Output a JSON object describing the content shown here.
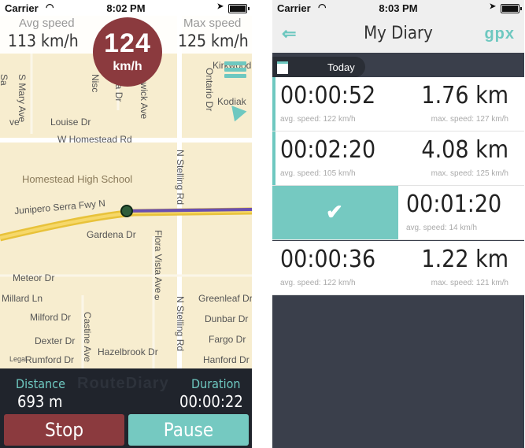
{
  "status_left": {
    "carrier": "Carrier",
    "time": "8:02 PM"
  },
  "status_right": {
    "carrier": "Carrier",
    "time": "8:03 PM"
  },
  "tracker": {
    "avg_speed_label": "Avg speed",
    "avg_speed_value": "113 km/h",
    "max_speed_label": "Max speed",
    "max_speed_value": "125 km/h",
    "current_speed": "124",
    "current_speed_unit": "km/h",
    "distance_label": "Distance",
    "distance_value": "693 m",
    "duration_label": "Duration",
    "duration_value": "00:00:22",
    "watermark": "RouteDiary",
    "stop_label": "Stop",
    "pause_label": "Pause"
  },
  "map": {
    "labels": {
      "kirkwood": "Kirkwood",
      "ontario": "Ontario Dr",
      "kodiak": "Kodiak",
      "s_mary": "S Mary Ave",
      "nisc": "Nisc",
      "toba": "toba Dr",
      "nswick": "nswick Ave",
      "louise": "Louise Dr",
      "w_homestead": "W Homestead Rd",
      "n_stelling_1": "N Stelling Rd",
      "school": "Homestead High School",
      "junipero": "Junipero Serra Fwy N",
      "gardena": "Gardena Dr",
      "flora": "Flora Vista Ave",
      "meteor": "Meteor Dr",
      "millard": "Millard Ln",
      "milford": "Milford Dr",
      "dexter": "Dexter Dr",
      "rumford": "Rumford Dr",
      "castine": "Castine Ave",
      "hazelbrook": "Hazelbrook Dr",
      "n_stelling_2": "N Stelling Rd",
      "greenleaf": "Greenleaf Dr",
      "dunbar": "Dunbar Dr",
      "fargo": "Fargo Dr",
      "hanford": "Hanford Dr",
      "legal": "Legal",
      "sa": "Sa",
      "ve": "ve",
      "e": "e"
    }
  },
  "diary": {
    "back_icon": "back-arrow-icon",
    "title": "My Diary",
    "export_label": "gpx",
    "section_label": "Today",
    "trips": [
      {
        "duration": "00:00:52",
        "avg": "avg. speed: 122 km/h",
        "distance": "1.76 km",
        "max": "max. speed: 127 km/h"
      },
      {
        "duration": "00:02:20",
        "avg": "avg. speed: 105 km/h",
        "distance": "4.08 km",
        "max": "max. speed: 125 km/h"
      },
      {
        "duration": "00:01:20",
        "avg": "avg. speed: 14 km/h"
      },
      {
        "duration": "00:00:36",
        "avg": "avg. speed: 122 km/h",
        "distance": "1.22 km",
        "max": "max. speed: 121 km/h"
      }
    ]
  },
  "colors": {
    "accent": "#75c9c1",
    "brand_red": "#8b3a3e",
    "dark": "#20242c"
  }
}
